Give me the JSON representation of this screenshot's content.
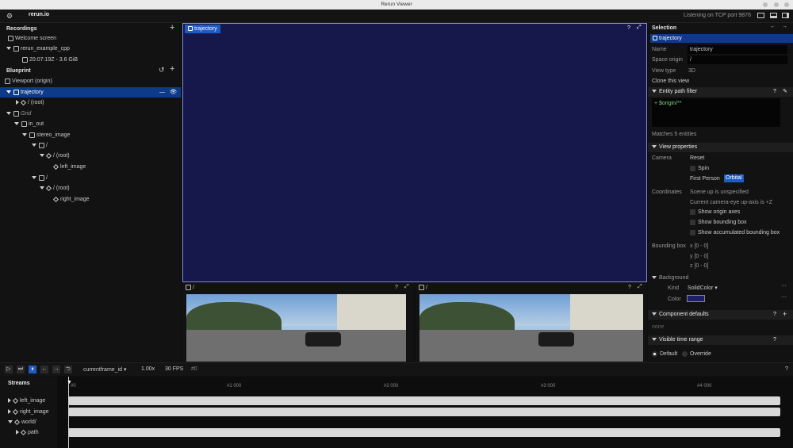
{
  "window": {
    "title": "Rerun Viewer"
  },
  "topbar": {
    "app_name": "rerun.io",
    "status": "Listening on TCP port 9876"
  },
  "recordings": {
    "header": "Recordings",
    "items": [
      {
        "label": "Welcome screen"
      },
      {
        "label": "rerun_example_cpp"
      },
      {
        "label": "20:07:19Z - 3.6 GiB"
      }
    ]
  },
  "blueprint": {
    "header": "Blueprint",
    "items": [
      {
        "label": "Viewport (origin)"
      },
      {
        "label": "trajectory"
      },
      {
        "label": "/ (root)"
      },
      {
        "label": "Grid"
      },
      {
        "label": "in_out"
      },
      {
        "label": "stereo_image"
      },
      {
        "label": "/"
      },
      {
        "label": "/ (root)"
      },
      {
        "label": "left_image"
      },
      {
        "label": "/"
      },
      {
        "label": "/ (root)"
      },
      {
        "label": "right_image"
      }
    ]
  },
  "view3d": {
    "tab": "trajectory",
    "help": "?"
  },
  "left_cam": {
    "tab": "/",
    "help": "?"
  },
  "right_cam": {
    "tab": "/",
    "help": "?"
  },
  "selection": {
    "header": "Selection",
    "badge": "trajectory",
    "name_label": "Name",
    "name_value": "trajectory",
    "origin_label": "Space origin",
    "origin_value": "/",
    "viewtype_label": "View type",
    "viewtype_value": "3D",
    "clone": "Clone this view",
    "filter_header": "Entity path filter",
    "filter_value": "+ $origin/**",
    "filter_matches": "Matches 5 entities",
    "viewprops_header": "View properties",
    "camera_label": "Camera",
    "reset": "Reset",
    "spin": "Spin",
    "first_person": "First Person",
    "orbital": "Orbital",
    "coords_label": "Coordinates",
    "coords_1": "Scene up is unspecified",
    "coords_2": "Current camera-eye up-axis is +Z",
    "show_origin": "Show origin axes",
    "show_bbox": "Show bounding box",
    "show_acc_bbox": "Show accumulated bounding box",
    "bbox_label": "Bounding box",
    "bbox_x": "x [0 - 0]",
    "bbox_y": "y [0 - 0]",
    "bbox_z": "z [0 - 0]",
    "background_label": "Background",
    "kind_label": "Kind",
    "kind_value": "SolidColor",
    "color_label": "Color",
    "bg_color": "#1d1f6b",
    "comp_defaults": "Component defaults",
    "none": "none",
    "time_range": "Visible time range",
    "default": "Default",
    "override": "Override"
  },
  "timeline": {
    "timeline_name": "currentframe_id",
    "speed": "1.00x",
    "fps": "30 FPS",
    "frame": "#0",
    "streams_header": "Streams",
    "ticks": [
      "#0",
      "#1 000",
      "#2 000",
      "#3 000",
      "#4 000"
    ],
    "streams": [
      {
        "label": "left_image"
      },
      {
        "label": "right_image"
      },
      {
        "label": "world/"
      },
      {
        "label": "path"
      }
    ]
  },
  "colors": {
    "accent": "#0d3b89",
    "view_bg": "#1a1a4d",
    "selected_tab": "#1e5bc6"
  }
}
